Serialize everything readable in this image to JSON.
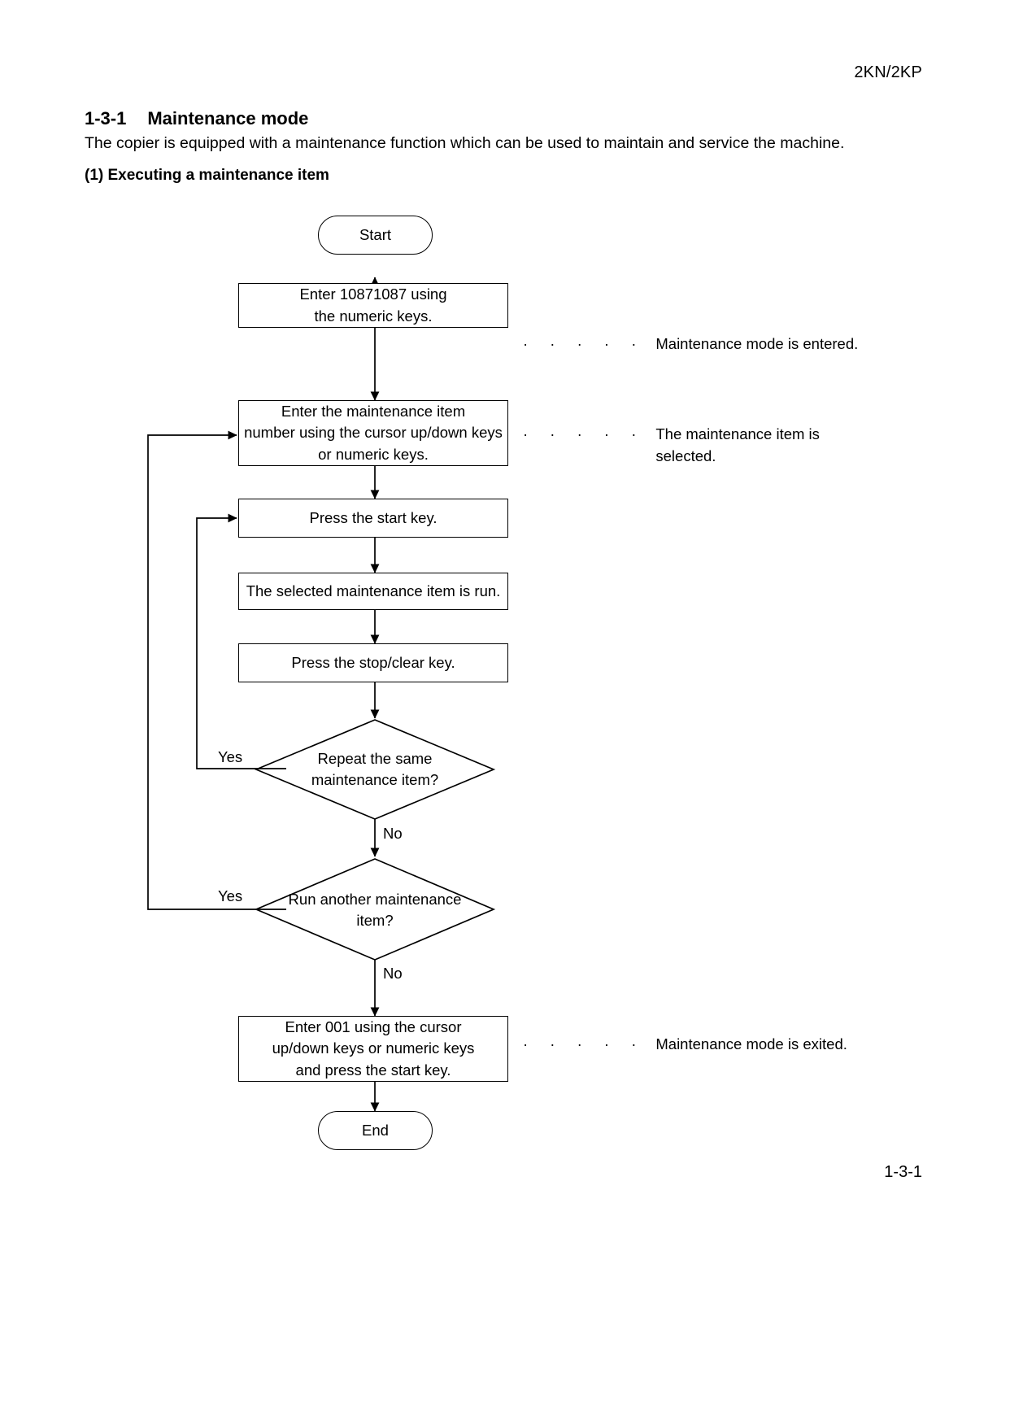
{
  "document": {
    "model_code": "2KN/2KP",
    "page_number": "1-3-1",
    "section_number": "1-3-1",
    "section_title": "Maintenance mode",
    "intro_paragraph": "The copier is equipped with a maintenance function which can be used to maintain and service the machine.",
    "subsection_title": "(1) Executing a maintenance item"
  },
  "chart_data": {
    "type": "diagram",
    "subtype": "flowchart",
    "title": "(1) Executing a maintenance item",
    "nodes": [
      {
        "id": "start",
        "shape": "terminator",
        "lines": [
          "Start"
        ]
      },
      {
        "id": "enter-code",
        "shape": "process",
        "lines": [
          "Enter 10871087 using",
          "the numeric keys."
        ]
      },
      {
        "id": "enter-item",
        "shape": "process",
        "lines": [
          "Enter the maintenance item",
          "number using the cursor up/down keys",
          "or numeric keys."
        ]
      },
      {
        "id": "press-start",
        "shape": "process",
        "lines": [
          "Press the start key."
        ]
      },
      {
        "id": "item-run",
        "shape": "process",
        "lines": [
          "The selected maintenance item is run."
        ]
      },
      {
        "id": "press-stop",
        "shape": "process",
        "lines": [
          "Press the stop/clear key."
        ]
      },
      {
        "id": "repeat-same",
        "shape": "decision",
        "lines": [
          "Repeat the same",
          "maintenance item?"
        ]
      },
      {
        "id": "run-another",
        "shape": "decision",
        "lines": [
          "Run another maintenance",
          "item?"
        ]
      },
      {
        "id": "enter-001",
        "shape": "process",
        "lines": [
          "Enter 001 using the cursor",
          "up/down keys or numeric keys",
          "and press the start key."
        ]
      },
      {
        "id": "end",
        "shape": "terminator",
        "lines": [
          "End"
        ]
      }
    ],
    "branch_labels": {
      "repeat_same_yes": "Yes",
      "repeat_same_no": "No",
      "run_another_yes": "Yes",
      "run_another_no": "No"
    },
    "annotations": [
      {
        "id": "annot-entered",
        "leader": "· · · · ·",
        "lines": [
          "Maintenance mode is entered."
        ]
      },
      {
        "id": "annot-selected",
        "leader": "· · · · ·",
        "lines": [
          "The maintenance item is",
          "selected."
        ]
      },
      {
        "id": "annot-exited",
        "leader": "· · · · ·",
        "lines": [
          "Maintenance mode is exited."
        ]
      }
    ],
    "colors": {
      "stroke": "#000000",
      "fill": "#ffffff",
      "page": "#ffffff"
    }
  }
}
